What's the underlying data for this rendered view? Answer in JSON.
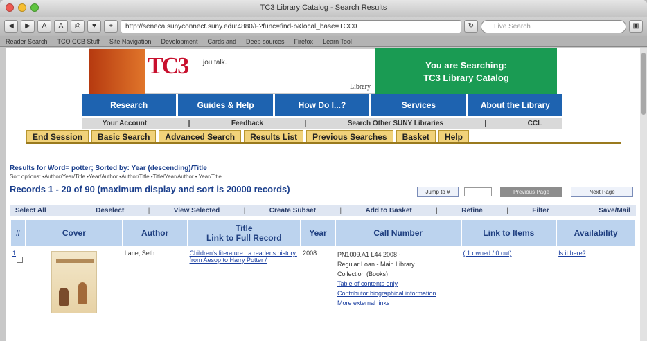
{
  "window_title": "TC3 Library Catalog - Search Results",
  "toolbar": {
    "url": "http://seneca.sunyconnect.suny.edu:4880/F?func=find-b&local_base=TCC0",
    "search_placeholder": "Live Search"
  },
  "bookmarks": [
    "Reader Search",
    "TCO CCB Stuff",
    "Site Navigation",
    "Development",
    "Cards and",
    "Deep sources",
    "Firefox",
    "Learn Tool"
  ],
  "banner": {
    "logo_text": "TC3",
    "tagline": "jou talk.",
    "logo_sub": "Library",
    "searching_line1": "You are Searching:",
    "searching_line2": "TC3 Library Catalog"
  },
  "nav": [
    "Research",
    "Guides & Help",
    "How Do I...?",
    "Services",
    "About the Library"
  ],
  "subnav": [
    "Your Account",
    "|",
    "Feedback",
    "|",
    "Search Other SUNY Libraries",
    "|",
    "CCL"
  ],
  "tabs": [
    "End Session",
    "Basic Search",
    "Advanced Search",
    "Results List",
    "Previous Searches",
    "Basket",
    "Help"
  ],
  "results_info": "Results for Word= potter; Sorted by: Year (descending)/Title",
  "sort_options": "Sort options: •Author/Year/Title •Year/Author •Author/Title •Title/Year/Author • Year/Title",
  "records": "Records 1 - 20 of 90 (maximum display and sort is 20000 records)",
  "jump_label": "Jump to #",
  "prev_label": "Previous Page",
  "next_label": "Next Page",
  "actions": [
    "Select All",
    "Deselect",
    "View Selected",
    "Create Subset",
    "Add to Basket",
    "Refine",
    "Filter",
    "Save/Mail"
  ],
  "table": {
    "headers": {
      "num": "#",
      "cover": "Cover",
      "author": "Author",
      "title1": "Title",
      "title2": "Link to Full Record",
      "year": "Year",
      "call": "Call Number",
      "items": "Link to Items",
      "avail": "Availability"
    },
    "row": {
      "num": "1",
      "author": "Lane, Seth.",
      "title": "Children's literature : a reader's history, from Aesop to Harry Potter /",
      "year": "2008",
      "call_line1": "PN1009.A1 L44 2008 -",
      "call_line2": "Regular Loan - Main Library",
      "call_line3": "Collection (Books)",
      "link1": "Table of contents only",
      "link2": "Contributor biographical information",
      "link3": "More external links",
      "items": "( 1 owned / 0 out)",
      "avail": "Is it here?"
    }
  }
}
